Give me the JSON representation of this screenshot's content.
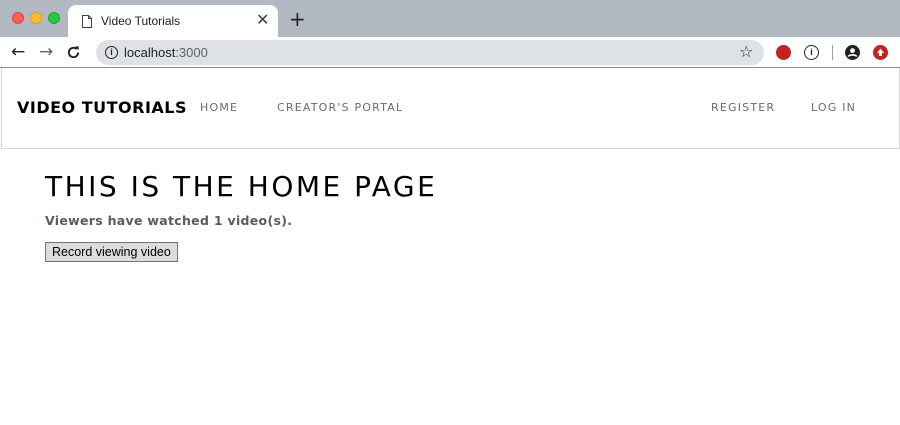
{
  "browser": {
    "tab": {
      "title": "Video Tutorials",
      "close_icon": "close-icon",
      "doc_icon": "page-document-icon"
    },
    "new_tab_label": "+",
    "toolbar": {
      "back_label": "←",
      "forward_label": "→",
      "reload_label": "⟳",
      "url_host": "localhost",
      "url_port": ":3000",
      "info_label": "i",
      "star_label": "☆"
    },
    "extensions": [
      {
        "name": "red-extension-icon",
        "color": "#c5221f"
      },
      {
        "name": "info-extension-icon",
        "label": "i"
      },
      {
        "name": "account-icon",
        "color": "#202124"
      },
      {
        "name": "red-extension-icon-2",
        "color": "#c5221f"
      }
    ],
    "colors": {
      "titlebar": "#b3b9c3",
      "omnibox": "#dee1e5"
    }
  },
  "site": {
    "brand": "VIDEO TUTORIALS",
    "nav": {
      "home": "HOME",
      "creators_portal": "CREATOR'S PORTAL",
      "register": "REGISTER",
      "login": "LOG IN"
    }
  },
  "main": {
    "title": "THIS IS THE HOME PAGE",
    "viewer_count_text": "Viewers have watched 1 video(s).",
    "record_button_label": "Record viewing video"
  }
}
